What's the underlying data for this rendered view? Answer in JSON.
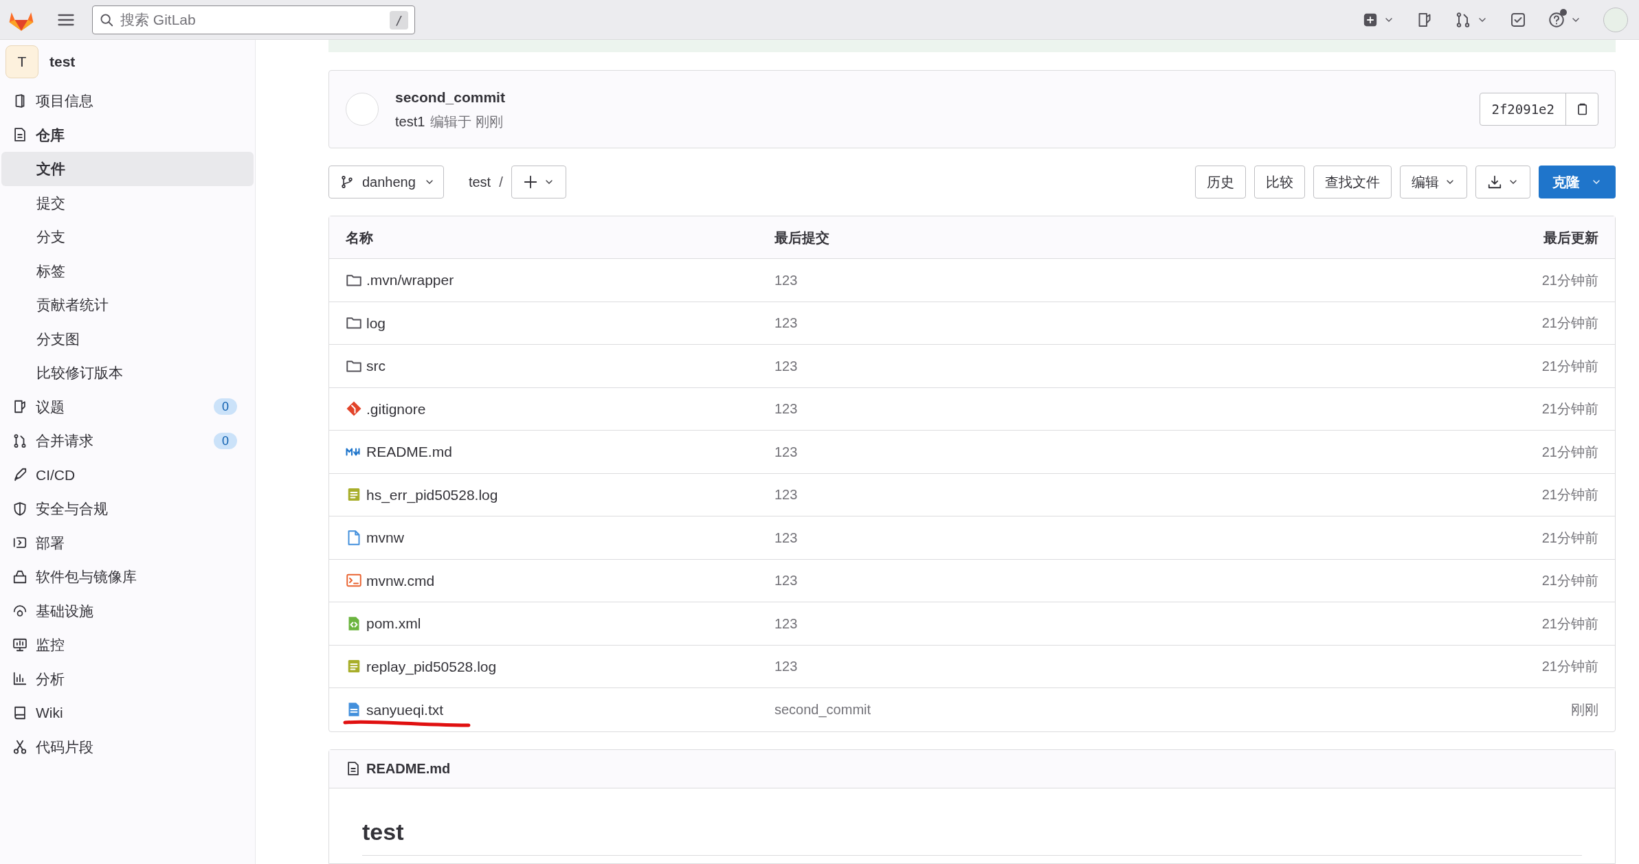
{
  "top_bar": {
    "search_placeholder": "搜索 GitLab",
    "search_shortcut": "/",
    "help_notification": true
  },
  "sidebar": {
    "project_initial": "T",
    "project_name": "test",
    "items": [
      {
        "label": "项目信息",
        "expanded": false
      },
      {
        "label": "仓库",
        "expanded": true,
        "children": [
          {
            "label": "文件",
            "selected": true
          },
          {
            "label": "提交",
            "selected": false
          },
          {
            "label": "分支",
            "selected": false
          },
          {
            "label": "标签",
            "selected": false
          },
          {
            "label": "贡献者统计",
            "selected": false
          },
          {
            "label": "分支图",
            "selected": false
          },
          {
            "label": "比较修订版本",
            "selected": false
          }
        ]
      },
      {
        "label": "议题",
        "expanded": false,
        "count": "0"
      },
      {
        "label": "合并请求",
        "expanded": false,
        "count": "0"
      },
      {
        "label": "CI/CD",
        "expanded": false
      },
      {
        "label": "安全与合规",
        "expanded": false
      },
      {
        "label": "部署",
        "expanded": false
      },
      {
        "label": "软件包与镜像库",
        "expanded": false
      },
      {
        "label": "基础设施",
        "expanded": false
      },
      {
        "label": "监控",
        "expanded": false
      },
      {
        "label": "分析",
        "expanded": false
      },
      {
        "label": "Wiki",
        "expanded": false
      },
      {
        "label": "代码片段",
        "expanded": false
      }
    ]
  },
  "commit": {
    "title": "second_commit",
    "author": "test1",
    "meta": "编辑于 刚刚",
    "sha": "2f2091e2"
  },
  "toolbar": {
    "branch": "danheng",
    "path": "test",
    "path_separator": "/",
    "buttons": [
      "历史",
      "比较",
      "查找文件",
      "编辑"
    ],
    "clone": "克隆"
  },
  "table": {
    "columns": [
      "名称",
      "最后提交",
      "最后更新"
    ],
    "rows": [
      {
        "kind": "folder",
        "name": ".mvn/wrapper",
        "commit": "123",
        "updated": "21分钟前",
        "underlined": false
      },
      {
        "kind": "folder",
        "name": "log",
        "commit": "123",
        "updated": "21分钟前",
        "underlined": false
      },
      {
        "kind": "folder",
        "name": "src",
        "commit": "123",
        "updated": "21分钟前",
        "underlined": false
      },
      {
        "kind": "git",
        "name": ".gitignore",
        "commit": "123",
        "updated": "21分钟前",
        "underlined": false
      },
      {
        "kind": "markdown",
        "name": "README.md",
        "commit": "123",
        "updated": "21分钟前",
        "underlined": false
      },
      {
        "kind": "log",
        "name": "hs_err_pid50528.log",
        "commit": "123",
        "updated": "21分钟前",
        "underlined": false
      },
      {
        "kind": "file",
        "name": "mvnw",
        "commit": "123",
        "updated": "21分钟前",
        "underlined": false
      },
      {
        "kind": "terminal",
        "name": "mvnw.cmd",
        "commit": "123",
        "updated": "21分钟前",
        "underlined": false
      },
      {
        "kind": "xml",
        "name": "pom.xml",
        "commit": "123",
        "updated": "21分钟前",
        "underlined": false
      },
      {
        "kind": "log",
        "name": "replay_pid50528.log",
        "commit": "123",
        "updated": "21分钟前",
        "underlined": false
      },
      {
        "kind": "text",
        "name": "sanyueqi.txt",
        "commit": "second_commit",
        "updated": "刚刚",
        "underlined": true
      }
    ]
  },
  "readme": {
    "filename": "README.md",
    "heading": "test"
  }
}
